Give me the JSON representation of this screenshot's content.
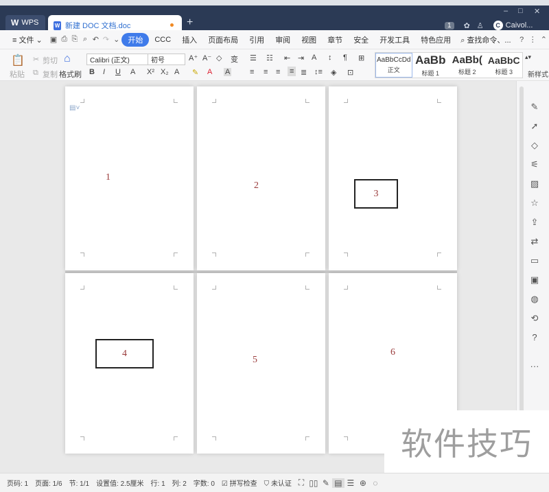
{
  "titlebar": {
    "wps_label": "WPS",
    "doc_tab_title": "新建 DOC 文档.doc",
    "add_tab": "+",
    "user_name": "Caivol...",
    "notification_count": "1",
    "minimize": "–",
    "maximize": "□",
    "close": "✕"
  },
  "menubar": {
    "file": "文件",
    "items": [
      "开始",
      "CCC",
      "插入",
      "页面布局",
      "引用",
      "审阅",
      "视图",
      "章节",
      "安全",
      "开发工具",
      "特色应用"
    ],
    "search": "查找命令、..."
  },
  "ribbon": {
    "paste": "粘贴",
    "cut": "剪切",
    "copy": "复制",
    "format_painter": "格式刷",
    "font_name": "Calibri (正文)",
    "font_size": "初号",
    "styles": [
      {
        "sample": "AaBbCcDd",
        "label": "正文"
      },
      {
        "sample": "AaBb",
        "label": "标题 1"
      },
      {
        "sample": "AaBb(",
        "label": "标题 2"
      },
      {
        "sample": "AaBbC",
        "label": "标题 3"
      }
    ],
    "new_style": "新样式"
  },
  "pages": {
    "p1": "1",
    "p2": "2",
    "p3": "3",
    "p4": "4",
    "p5": "5",
    "p6": "6"
  },
  "watermark": "软件技巧",
  "statusbar": {
    "page_code": "页码: 1",
    "page": "页面: 1/6",
    "section": "节: 1/1",
    "setting": "设置值: 2.5厘米",
    "row": "行: 1",
    "col": "列: 2",
    "word_count": "字数: 0",
    "spell_check": "拼写检查",
    "uncertified": "未认证"
  },
  "colors": {
    "titlebar": "#2b3a55",
    "accent": "#3f7bea",
    "page_number": "#9a3b3b"
  }
}
